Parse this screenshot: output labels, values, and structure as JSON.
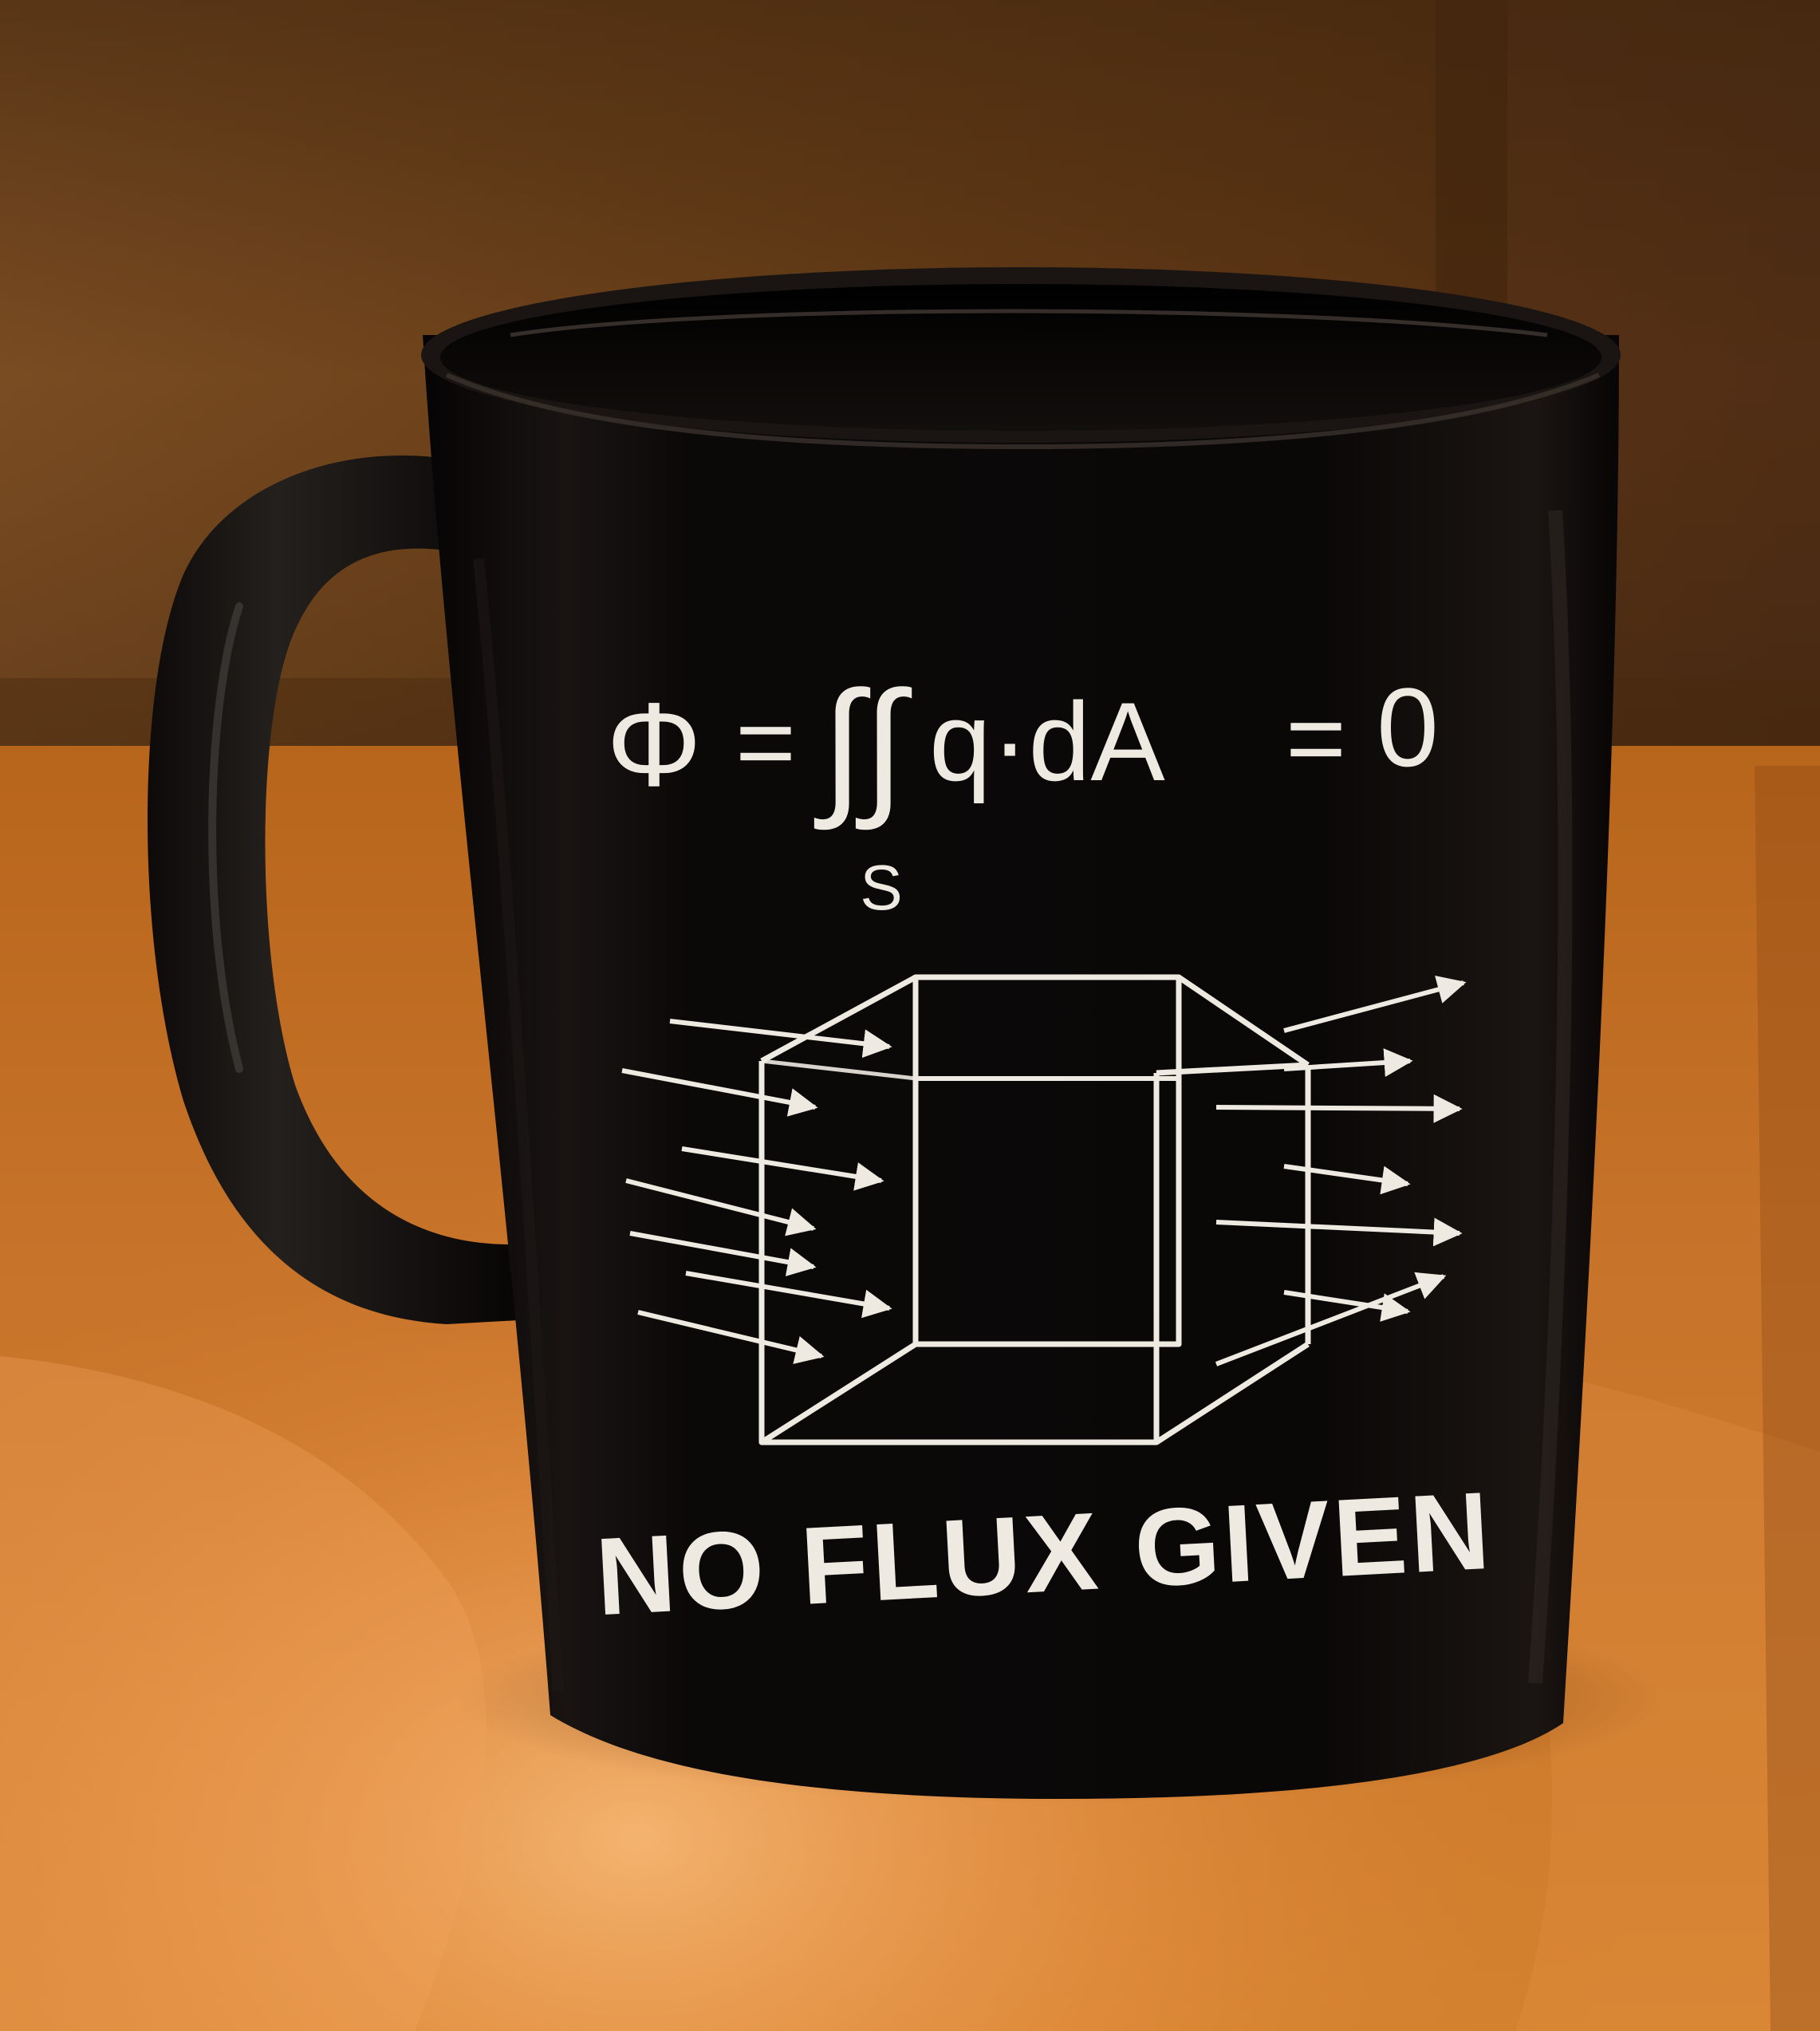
{
  "mug": {
    "equation": {
      "lhs": "Φ",
      "equals_1": "=",
      "integral": "∫∫",
      "integrand": "q·dA",
      "equals_2": "=",
      "rhs": "0",
      "subscript": "S"
    },
    "caption": "NO FLUX GIVEN"
  },
  "colors": {
    "mug_body": "#0a0807",
    "print": "#eeeae2",
    "wall_wood": "#6e4520",
    "table_wood": "#c56f22",
    "table_highlight": "#f2a45c"
  },
  "icons": {
    "diagram": "cube-with-flux-arrows-icon"
  }
}
